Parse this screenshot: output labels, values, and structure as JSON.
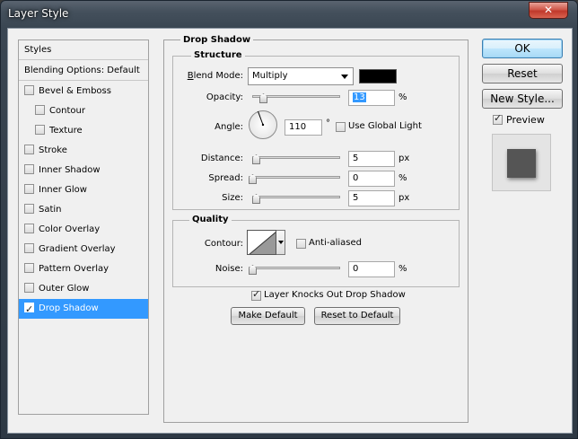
{
  "window": {
    "title": "Layer Style",
    "close_glyph": "✕"
  },
  "style_list": {
    "header_styles": "Styles",
    "header_blending": "Blending Options: Default",
    "items": [
      {
        "label": "Bevel & Emboss",
        "checked": false,
        "indent": false
      },
      {
        "label": "Contour",
        "checked": false,
        "indent": true
      },
      {
        "label": "Texture",
        "checked": false,
        "indent": true
      },
      {
        "label": "Stroke",
        "checked": false,
        "indent": false
      },
      {
        "label": "Inner Shadow",
        "checked": false,
        "indent": false
      },
      {
        "label": "Inner Glow",
        "checked": false,
        "indent": false
      },
      {
        "label": "Satin",
        "checked": false,
        "indent": false
      },
      {
        "label": "Color Overlay",
        "checked": false,
        "indent": false
      },
      {
        "label": "Gradient Overlay",
        "checked": false,
        "indent": false
      },
      {
        "label": "Pattern Overlay",
        "checked": false,
        "indent": false
      },
      {
        "label": "Outer Glow",
        "checked": false,
        "indent": false
      },
      {
        "label": "Drop Shadow",
        "checked": true,
        "indent": false,
        "selected": true
      }
    ]
  },
  "drop_shadow": {
    "section_title": "Drop Shadow",
    "structure_title": "Structure",
    "blend_mode_label": "Blend Mode:",
    "blend_mode_value": "Multiply",
    "shadow_color": "#000000",
    "opacity_label": "Opacity:",
    "opacity_value": "13",
    "opacity_unit": "%",
    "angle_label": "Angle:",
    "angle_value": "110",
    "angle_unit": "°",
    "use_global_light_label": "Use Global Light",
    "use_global_light_checked": false,
    "distance_label": "Distance:",
    "distance_value": "5",
    "distance_unit": "px",
    "spread_label": "Spread:",
    "spread_value": "0",
    "spread_unit": "%",
    "size_label": "Size:",
    "size_value": "5",
    "size_unit": "px",
    "quality_title": "Quality",
    "contour_label": "Contour:",
    "anti_aliased_label": "Anti-aliased",
    "anti_aliased_checked": false,
    "noise_label": "Noise:",
    "noise_value": "0",
    "noise_unit": "%",
    "knocks_out_label": "Layer Knocks Out Drop Shadow",
    "knocks_out_checked": true,
    "make_default_label": "Make Default",
    "reset_default_label": "Reset to Default"
  },
  "buttons": {
    "ok": "OK",
    "reset": "Reset",
    "new_style": "New Style...",
    "preview_label": "Preview",
    "preview_checked": true
  }
}
